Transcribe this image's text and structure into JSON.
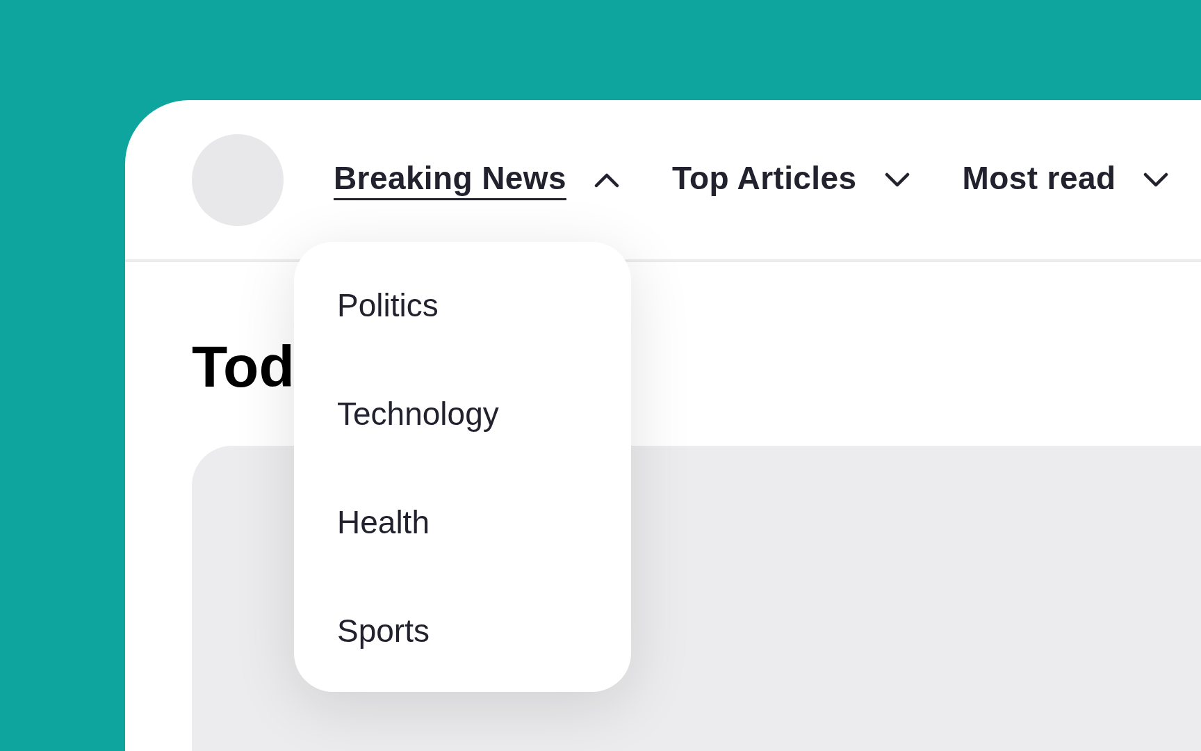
{
  "nav": {
    "items": [
      {
        "label": "Breaking News",
        "selected": true,
        "expanded": true
      },
      {
        "label": "Top Articles",
        "selected": false,
        "expanded": false
      },
      {
        "label": "Most read",
        "selected": false,
        "expanded": false
      }
    ]
  },
  "dropdown": {
    "items": [
      {
        "label": "Politics"
      },
      {
        "label": "Technology"
      },
      {
        "label": "Health"
      },
      {
        "label": "Sports"
      }
    ]
  },
  "heading": "Tod"
}
